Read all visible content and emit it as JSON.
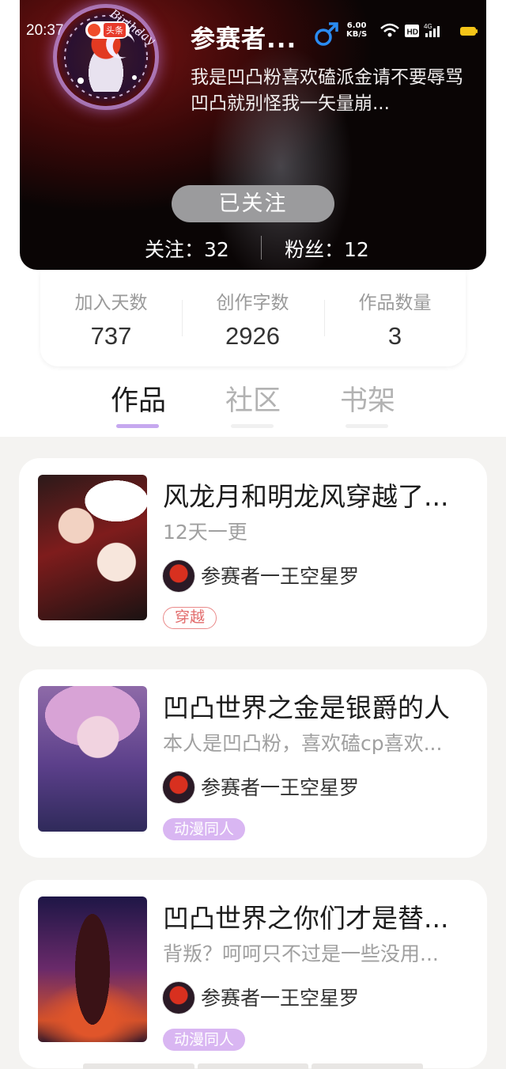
{
  "status_bar": {
    "time": "20:37",
    "net_speed_value": "6.00",
    "net_speed_unit": "KB/S"
  },
  "profile": {
    "username": "参赛者...",
    "gender": "male",
    "bio": "我是凹凸粉喜欢磕派金请不要辱骂凹凸就别怪我一矢量崩...",
    "avatar_badge_text": "头条",
    "avatar_frame_text": "Birthday",
    "follow_button_label": "已关注",
    "following_text": "关注：32",
    "fans_text": "粉丝：12"
  },
  "stats": [
    {
      "label": "加入天数",
      "value": "737"
    },
    {
      "label": "创作字数",
      "value": "2926"
    },
    {
      "label": "作品数量",
      "value": "3"
    }
  ],
  "tabs": [
    {
      "label": "作品",
      "active": true
    },
    {
      "label": "社区",
      "active": false
    },
    {
      "label": "书架",
      "active": false
    }
  ],
  "works": [
    {
      "title": "风龙月和明龙风穿越了...",
      "subtitle": "12天一更",
      "author": "参赛者一王空星罗",
      "tag": "穿越",
      "tag_style": "outline"
    },
    {
      "title": "凹凸世界之金是银爵的人",
      "subtitle": "本人是凹凸粉，喜欢磕cp喜欢...",
      "author": "参赛者一王空星罗",
      "tag": "动漫同人",
      "tag_style": "fill"
    },
    {
      "title": "凹凸世界之你们才是替...",
      "subtitle": "背叛？呵呵只不过是一些没用...",
      "author": "参赛者一王空星罗",
      "tag": "动漫同人",
      "tag_style": "fill"
    }
  ],
  "colors": {
    "accent_purple": "#c6a8ef",
    "tag_purple": "#d9b6f2",
    "tag_red": "#e26b6b",
    "gender_blue": "#2a8bf2"
  }
}
